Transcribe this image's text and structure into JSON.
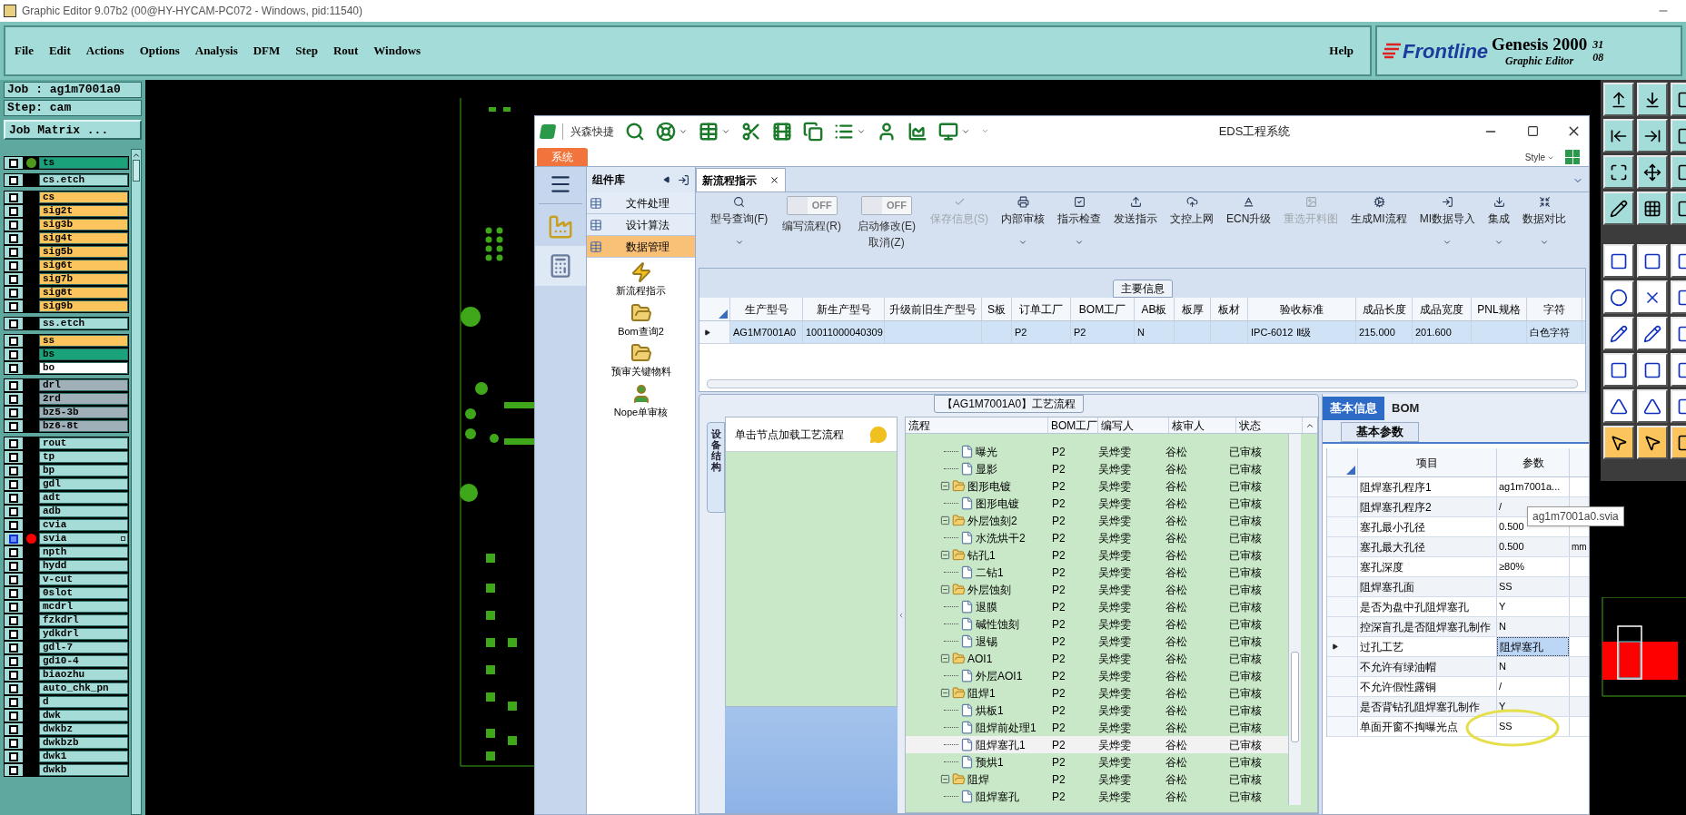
{
  "app_title": "Graphic Editor 9.07b2 (00@HY-HYCAM-PC072 - Windows, pid:11540)",
  "menu": [
    "File",
    "Edit",
    "Actions",
    "Options",
    "Analysis",
    "DFM",
    "Step",
    "Rout",
    "Windows"
  ],
  "help": "Help",
  "brand": {
    "logo": "Frontline",
    "product": "Genesis 2000",
    "subtitle": "Graphic Editor",
    "corner_1": "31",
    "corner_2": "08"
  },
  "job": {
    "job": "Job : ag1m7001a0",
    "step": "Step: cam",
    "matrix_button": "Job Matrix ..."
  },
  "layer_groups": [
    {
      "layers": [
        {
          "name": "ts",
          "color": "#1aa37a",
          "selected": false,
          "dot": {
            "color": "#4f9a1c"
          }
        }
      ]
    },
    {
      "layers": [
        {
          "name": "cs.etch",
          "color": "#a6dcd8",
          "selected": false
        }
      ]
    },
    {
      "layers": [
        {
          "name": "cs",
          "color": "#fcc45c",
          "selected": false
        },
        {
          "name": "sig2t",
          "color": "#fcc45c",
          "selected": false
        },
        {
          "name": "sig3b",
          "color": "#fcc45c",
          "selected": false
        },
        {
          "name": "sig4t",
          "color": "#fcc45c",
          "selected": false
        },
        {
          "name": "sig5b",
          "color": "#fcc45c",
          "selected": false
        },
        {
          "name": "sig6t",
          "color": "#fcc45c",
          "selected": false
        },
        {
          "name": "sig7b",
          "color": "#fcc45c",
          "selected": false
        },
        {
          "name": "sig8t",
          "color": "#fcc45c",
          "selected": false
        },
        {
          "name": "sig9b",
          "color": "#fcc45c",
          "selected": false
        }
      ]
    },
    {
      "layers": [
        {
          "name": "ss.etch",
          "color": "#a6dcd8",
          "selected": false
        }
      ]
    },
    {
      "layers": [
        {
          "name": "ss",
          "color": "#fcc45c",
          "selected": false
        },
        {
          "name": "bs",
          "color": "#1aa37a",
          "selected": false
        },
        {
          "name": "bo",
          "color": "#ffffff",
          "selected": false
        }
      ]
    },
    {
      "layers": [
        {
          "name": "drl",
          "color": "#9fb0b9",
          "selected": false
        },
        {
          "name": "2rd",
          "color": "#9fb0b9",
          "selected": false
        },
        {
          "name": "bz5-3b",
          "color": "#9fb0b9",
          "selected": false
        },
        {
          "name": "bz6-8t",
          "color": "#9fb0b9",
          "selected": false
        }
      ]
    },
    {
      "layers": [
        {
          "name": "rout",
          "color": "#a6dcd8",
          "selected": false
        },
        {
          "name": "tp",
          "color": "#a6dcd8",
          "selected": false
        },
        {
          "name": "bp",
          "color": "#a6dcd8",
          "selected": false
        },
        {
          "name": "gdl",
          "color": "#a6dcd8",
          "selected": false
        },
        {
          "name": "adt",
          "color": "#a6dcd8",
          "selected": false
        },
        {
          "name": "adb",
          "color": "#a6dcd8",
          "selected": false
        },
        {
          "name": "cvia",
          "color": "#a6dcd8",
          "selected": false
        },
        {
          "name": "svia",
          "color": "#a6dcd8",
          "selected": true,
          "dot": {
            "color": "#ff0000"
          }
        },
        {
          "name": "npth",
          "color": "#a6dcd8",
          "selected": false
        },
        {
          "name": "hydd",
          "color": "#a6dcd8",
          "selected": false
        },
        {
          "name": "v-cut",
          "color": "#a6dcd8",
          "selected": false
        },
        {
          "name": "0slot",
          "color": "#a6dcd8",
          "selected": false
        },
        {
          "name": "mcdrl",
          "color": "#a6dcd8",
          "selected": false
        },
        {
          "name": "fzkdrl",
          "color": "#a6dcd8",
          "selected": false
        },
        {
          "name": "ydkdrl",
          "color": "#a6dcd8",
          "selected": false
        },
        {
          "name": "gdl-7",
          "color": "#a6dcd8",
          "selected": false
        },
        {
          "name": "gd10-4",
          "color": "#a6dcd8",
          "selected": false
        },
        {
          "name": "biaozhu",
          "color": "#a6dcd8",
          "selected": false
        },
        {
          "name": "auto_chk_pn",
          "color": "#a6dcd8",
          "selected": false
        },
        {
          "name": "d",
          "color": "#a6dcd8",
          "selected": false
        },
        {
          "name": "dwk",
          "color": "#a6dcd8",
          "selected": false
        },
        {
          "name": "dwkbz",
          "color": "#a6dcd8",
          "selected": false
        },
        {
          "name": "dwkbzb",
          "color": "#a6dcd8",
          "selected": false
        },
        {
          "name": "dwk1",
          "color": "#a6dcd8",
          "selected": false
        },
        {
          "name": "dwkb",
          "color": "#a6dcd8",
          "selected": false
        }
      ]
    }
  ],
  "eds": {
    "brand": "兴森快捷",
    "title": "EDS工程系统",
    "system_tab": "系统",
    "style_label": "Style",
    "nav_header": "组件库",
    "nav_groups": [
      {
        "label": "文件处理",
        "selected": false
      },
      {
        "label": "设计算法",
        "selected": false
      },
      {
        "label": "数据管理",
        "selected": true
      }
    ],
    "nav_items": [
      "新流程指示",
      "Bom查询2",
      "预审关键物料",
      "Nope单审核"
    ],
    "doc_tab": {
      "label": "新流程指示",
      "selected": true
    },
    "ribbon": [
      {
        "kind": "button",
        "label": "型号查询(F)",
        "dropdown": true,
        "disabled": false
      },
      {
        "kind": "toggle",
        "label": "编写流程(R)",
        "state_text": "OFF",
        "on": false
      },
      {
        "kind": "toggle",
        "label": "启动修改(E)",
        "sublabel": "取消(Z)",
        "state_text": "OFF",
        "on": false
      },
      {
        "kind": "button",
        "label": "保存信息(S)",
        "dropdown": false,
        "disabled": true
      },
      {
        "kind": "button",
        "label": "内部审核",
        "dropdown": true,
        "disabled": false
      },
      {
        "kind": "button",
        "label": "指示检查",
        "dropdown": true,
        "disabled": false
      },
      {
        "kind": "button",
        "label": "发送指示",
        "dropdown": false,
        "disabled": false
      },
      {
        "kind": "button",
        "label": "文控上网",
        "dropdown": false,
        "disabled": false
      },
      {
        "kind": "button",
        "label": "ECN升级",
        "dropdown": false,
        "disabled": false
      },
      {
        "kind": "button",
        "label": "重选开料图",
        "dropdown": false,
        "disabled": true
      },
      {
        "kind": "button",
        "label": "生成MI流程",
        "dropdown": false,
        "disabled": false
      },
      {
        "kind": "button",
        "label": "MI数据导入",
        "dropdown": true,
        "disabled": false
      },
      {
        "kind": "button",
        "label": "集成",
        "dropdown": true,
        "disabled": false
      },
      {
        "kind": "button",
        "label": "数据对比",
        "dropdown": true,
        "disabled": false
      }
    ],
    "main_info": {
      "caption": "主要信息",
      "columns": [
        "生产型号",
        "新生产型号",
        "升级前旧生产型号",
        "S板",
        "订单工厂",
        "BOM工厂",
        "AB板",
        "板厚",
        "板材",
        "验收标准",
        "成品长度",
        "成品宽度",
        "PNL规格",
        "字符"
      ],
      "rows": [
        {
          "selected": true,
          "cells": [
            "AG1M7001A0",
            "10011000040309",
            null,
            null,
            "P2",
            "P2",
            "N",
            null,
            null,
            "IPC-6012 Ⅱ级",
            "215.000",
            "201.600",
            null,
            "白色字符"
          ]
        }
      ]
    },
    "process": {
      "caption": "【AG1M7001A0】工艺流程",
      "side_tab": "设备结构",
      "hint": "单击节点加载工艺流程",
      "columns": [
        "流程",
        "BOM工厂",
        "编写人",
        "核审人",
        "状态"
      ],
      "tree": [
        {
          "children": [
            {
              "name": "曝光",
              "bom": "P2",
              "writer": "吴烨雯",
              "reviewer": "谷松",
              "status": "已审核",
              "selected": false
            },
            {
              "name": "显影",
              "bom": "P2",
              "writer": "吴烨雯",
              "reviewer": "谷松",
              "status": "已审核",
              "selected": false
            }
          ]
        },
        {
          "name": "图形电镀",
          "bom": "P2",
          "writer": "吴烨雯",
          "reviewer": "谷松",
          "status": "已审核",
          "selected": false,
          "expanded": true,
          "children": [
            {
              "name": "图形电镀",
              "bom": "P2",
              "writer": "吴烨雯",
              "reviewer": "谷松",
              "status": "已审核",
              "selected": false
            }
          ]
        },
        {
          "name": "外层蚀刻2",
          "bom": "P2",
          "writer": "吴烨雯",
          "reviewer": "谷松",
          "status": "已审核",
          "selected": false,
          "expanded": true,
          "children": [
            {
              "name": "水洗烘干2",
              "bom": "P2",
              "writer": "吴烨雯",
              "reviewer": "谷松",
              "status": "已审核",
              "selected": false
            }
          ]
        },
        {
          "name": "钻孔1",
          "bom": "P2",
          "writer": "吴烨雯",
          "reviewer": "谷松",
          "status": "已审核",
          "selected": false,
          "expanded": true,
          "children": [
            {
              "name": "二钻1",
              "bom": "P2",
              "writer": "吴烨雯",
              "reviewer": "谷松",
              "status": "已审核",
              "selected": false
            }
          ]
        },
        {
          "name": "外层蚀刻",
          "bom": "P2",
          "writer": "吴烨雯",
          "reviewer": "谷松",
          "status": "已审核",
          "selected": false,
          "expanded": true,
          "children": [
            {
              "name": "退膜",
              "bom": "P2",
              "writer": "吴烨雯",
              "reviewer": "谷松",
              "status": "已审核",
              "selected": false
            },
            {
              "name": "碱性蚀刻",
              "bom": "P2",
              "writer": "吴烨雯",
              "reviewer": "谷松",
              "status": "已审核",
              "selected": false
            },
            {
              "name": "退锡",
              "bom": "P2",
              "writer": "吴烨雯",
              "reviewer": "谷松",
              "status": "已审核",
              "selected": false
            }
          ]
        },
        {
          "name": "AOI1",
          "bom": "P2",
          "writer": "吴烨雯",
          "reviewer": "谷松",
          "status": "已审核",
          "selected": false,
          "expanded": true,
          "children": [
            {
              "name": "外层AOI1",
              "bom": "P2",
              "writer": "吴烨雯",
              "reviewer": "谷松",
              "status": "已审核",
              "selected": false
            }
          ]
        },
        {
          "name": "阻焊1",
          "bom": "P2",
          "writer": "吴烨雯",
          "reviewer": "谷松",
          "status": "已审核",
          "selected": false,
          "expanded": true,
          "children": [
            {
              "name": "烘板1",
              "bom": "P2",
              "writer": "吴烨雯",
              "reviewer": "谷松",
              "status": "已审核",
              "selected": false
            },
            {
              "name": "阻焊前处理1",
              "bom": "P2",
              "writer": "吴烨雯",
              "reviewer": "谷松",
              "status": "已审核",
              "selected": false
            },
            {
              "name": "阻焊塞孔1",
              "bom": "P2",
              "writer": "吴烨雯",
              "reviewer": "谷松",
              "status": "已审核",
              "selected": true
            },
            {
              "name": "预烘1",
              "bom": "P2",
              "writer": "吴烨雯",
              "reviewer": "谷松",
              "status": "已审核",
              "selected": false
            }
          ]
        },
        {
          "name": "阻焊",
          "bom": "P2",
          "writer": "吴烨雯",
          "reviewer": "谷松",
          "status": "已审核",
          "selected": false,
          "expanded": true,
          "children": [
            {
              "name": "阻焊塞孔",
              "bom": "P2",
              "writer": "吴烨雯",
              "reviewer": "谷松",
              "status": "已审核",
              "selected": false
            }
          ]
        }
      ]
    },
    "details": {
      "tabs": [
        {
          "label": "基本信息",
          "selected": true
        },
        {
          "label": "BOM",
          "selected": false
        }
      ],
      "subtab": "基本参数",
      "columns": [
        "项目",
        "参数"
      ],
      "rows": [
        {
          "item": "阻焊塞孔程序1",
          "value": "ag1m7001a...",
          "selected": false,
          "highlighted": false
        },
        {
          "item": "阻焊塞孔程序2",
          "value": "/",
          "selected": false,
          "highlighted": false
        },
        {
          "item": "塞孔最小孔径",
          "value": "0.500",
          "selected": false,
          "highlighted": false
        },
        {
          "item": "塞孔最大孔径",
          "value": "0.500",
          "unit": "mm",
          "selected": false,
          "highlighted": false
        },
        {
          "item": "塞孔深度",
          "value": "≥80%",
          "selected": false,
          "highlighted": false
        },
        {
          "item": "阻焊塞孔面",
          "value": "SS",
          "selected": false,
          "highlighted": false
        },
        {
          "item": "是否为盘中孔阻焊塞孔",
          "value": "Y",
          "selected": false,
          "highlighted": false
        },
        {
          "item": "控深盲孔是否阻焊塞孔制作",
          "value": "N",
          "selected": false,
          "highlighted": false
        },
        {
          "item": "过孔工艺",
          "value": "阻焊塞孔",
          "selected": true,
          "highlighted": false
        },
        {
          "item": "不允许有绿油帽",
          "value": "N",
          "selected": false,
          "highlighted": false
        },
        {
          "item": "不允许假性露铜",
          "value": "/",
          "selected": false,
          "highlighted": false
        },
        {
          "item": "是否背钻孔阻焊塞孔制作",
          "value": "Y",
          "selected": false,
          "highlighted": false
        },
        {
          "item": "单面开窗不掏曝光点",
          "value": "SS",
          "selected": false,
          "highlighted": true
        }
      ]
    },
    "tooltip": "ag1m7001a0.svia"
  }
}
